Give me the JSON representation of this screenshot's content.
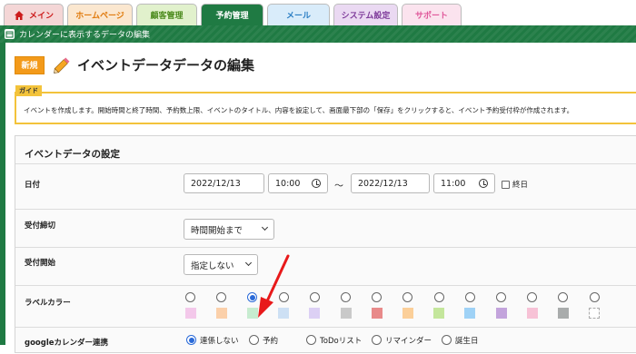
{
  "tabs": [
    {
      "label": "メイン",
      "bg": "#f4d6d6",
      "color": "#cc1b1b",
      "icon": "home-icon"
    },
    {
      "label": "ホームページ",
      "bg": "#fbe7cf",
      "color": "#e07b0e"
    },
    {
      "label": "顧客管理",
      "bg": "#e1f1cc",
      "color": "#4d8c1f"
    },
    {
      "label": "予約管理",
      "bg": "#1f7a43",
      "color": "#ffffff"
    },
    {
      "label": "メール",
      "bg": "#d9ecfa",
      "color": "#2c7fc4"
    },
    {
      "label": "システム設定",
      "bg": "#ead9f2",
      "color": "#7e3a9a"
    },
    {
      "label": "サポート",
      "bg": "#fbe3ee",
      "color": "#e0579a"
    }
  ],
  "window": {
    "title": "カレンダーに表示するデータの編集",
    "icon": "calendar-icon"
  },
  "header": {
    "badge": "新規",
    "icon": "pencil-icon",
    "title": "イベントデータデータの編集"
  },
  "guide": {
    "tag": "ガイド",
    "text": "イベントを作成します。開始時間と終了時間、予約数上限、イベントのタイトル、内容を設定して、画面最下部の「保存」をクリックすると、イベント予約受付枠が作成されます。"
  },
  "form": {
    "section_title": "イベントデータの設定",
    "date": {
      "label": "日付",
      "start_date": "2022/12/13",
      "start_time": "10:00",
      "separator": "〜",
      "end_date": "2022/12/13",
      "end_time": "11:00",
      "all_day_label": "終日",
      "all_day_checked": false
    },
    "deadline": {
      "label": "受付締切",
      "value": "時間開始まで"
    },
    "start": {
      "label": "受付開始",
      "value": "指定しない"
    },
    "label_color": {
      "label": "ラベルカラー",
      "selected_index": 2,
      "colors": [
        "#f3c8ea",
        "#fbd0aa",
        "#c7ecd0",
        "#cde0f4",
        "#dcd0f4",
        "#c9c9c9",
        "#e88a8a",
        "#fbcf99",
        "#c4e69c",
        "#9fd2f6",
        "#c3a4dc",
        "#f7c2d6",
        "#a9acac",
        "none"
      ]
    },
    "google_sync": {
      "label": "googleカレンダー連携",
      "options": [
        "連係しない",
        "予約",
        "ToDoリスト",
        "リマインダー",
        "誕生日"
      ],
      "selected_index": 0
    }
  },
  "annotation_arrow_color": "#e8191a"
}
